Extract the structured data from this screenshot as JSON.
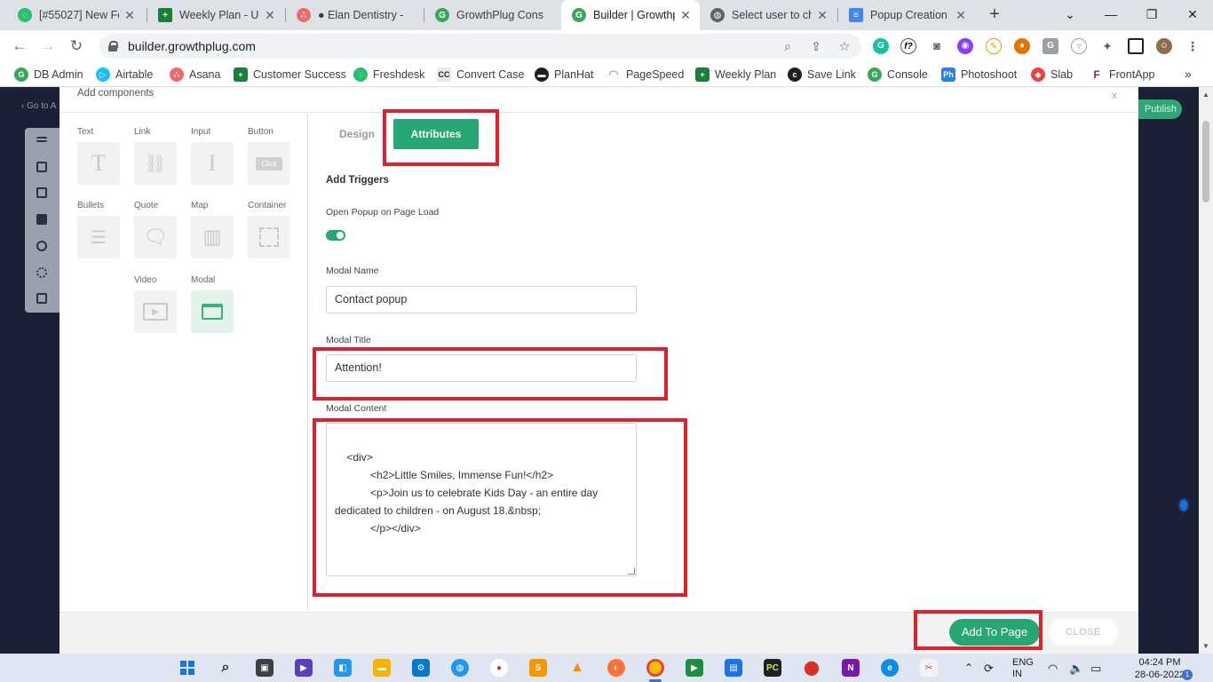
{
  "browser": {
    "tabs": [
      {
        "title": "[#55027] New Fe",
        "favicon": "freshdesk-icon",
        "color": "#25c16f",
        "active": false
      },
      {
        "title": "Weekly Plan - UI/",
        "favicon": "sheets-icon",
        "color": "#188038",
        "active": false
      },
      {
        "title": "● Elan Dentistry -",
        "favicon": "asana-icon",
        "color": "#f06a6a",
        "active": false
      },
      {
        "title": "GrowthPlug Cons",
        "favicon": "growthplug-icon",
        "color": "#3aa757",
        "active": false
      },
      {
        "title": "Builder | Growthp",
        "favicon": "growthplug-icon",
        "color": "#3aa757",
        "active": true
      },
      {
        "title": "Select user to ch",
        "favicon": "globe-icon",
        "color": "#5f6368",
        "active": false
      },
      {
        "title": "Popup Creation -",
        "favicon": "docs-icon",
        "color": "#4285f4",
        "active": false
      }
    ],
    "url": "builder.growthplug.com",
    "bookmarks": [
      {
        "label": "DB Admin",
        "icon": "growthplug-icon",
        "color": "#3aa757"
      },
      {
        "label": "Airtable",
        "icon": "airtable-icon",
        "color": "#18bfff"
      },
      {
        "label": "Asana",
        "icon": "asana-icon",
        "color": "#f06a6a"
      },
      {
        "label": "Customer Success",
        "icon": "sheets-icon",
        "color": "#188038"
      },
      {
        "label": "Freshdesk",
        "icon": "freshdesk-icon",
        "color": "#25c16f"
      },
      {
        "label": "Convert Case",
        "icon": "convert-case-icon",
        "color": "#555555"
      },
      {
        "label": "PlanHat",
        "icon": "planhat-icon",
        "color": "#1f1f1f"
      },
      {
        "label": "PageSpeed",
        "icon": "pagespeed-icon",
        "color": "#4285f4"
      },
      {
        "label": "Weekly Plan",
        "icon": "sheets-icon",
        "color": "#188038"
      },
      {
        "label": "Save Link",
        "icon": "save-link-icon",
        "color": "#1f1f1f"
      },
      {
        "label": "Console",
        "icon": "growthplug-icon",
        "color": "#3aa757"
      },
      {
        "label": "Photoshoot",
        "icon": "photoshop-icon",
        "color": "#2d7fe6"
      },
      {
        "label": "Slab",
        "icon": "slab-icon",
        "color": "#e8453c"
      },
      {
        "label": "FrontApp",
        "icon": "frontapp-icon",
        "color": "#a01e6e"
      }
    ],
    "convert_case_abbr": "CC",
    "photoshoot_abbr": "Ph"
  },
  "page": {
    "goto_label": "Go to A",
    "publish_label": "Publish"
  },
  "modal": {
    "title": "Add components",
    "close_label": "x",
    "components": [
      {
        "label": "Text",
        "icon": "text-icon",
        "glyph": "T"
      },
      {
        "label": "Link",
        "icon": "link-icon",
        "glyph": "🔗"
      },
      {
        "label": "Input",
        "icon": "input-icon",
        "glyph": "I"
      },
      {
        "label": "Button",
        "icon": "button-icon",
        "glyph": "Click"
      },
      {
        "label": "Bullets",
        "icon": "bullets-icon",
        "glyph": "☰"
      },
      {
        "label": "Quote",
        "icon": "quote-icon",
        "glyph": "☐"
      },
      {
        "label": "Map",
        "icon": "map-icon",
        "glyph": "▥"
      },
      {
        "label": "Container",
        "icon": "container-icon",
        "glyph": "⬚"
      },
      {
        "label": "Video",
        "icon": "video-icon",
        "glyph": "▶"
      },
      {
        "label": "Modal",
        "icon": "modal-icon",
        "glyph": "▭"
      }
    ],
    "tabs": {
      "design": "Design",
      "attributes": "Attributes"
    },
    "form": {
      "triggers_heading": "Add Triggers",
      "open_on_load_label": "Open Popup on Page Load",
      "open_on_load": true,
      "modal_name_label": "Modal Name",
      "modal_name_value": "Contact popup",
      "modal_title_label": "Modal Title",
      "modal_title_value": "Attention!",
      "modal_content_label": "Modal Content",
      "modal_content_value": "<div>\n            <h2>Little Smiles, Immense Fun!</h2>\n            <p>Join us to celebrate Kids Day - an entire day dedicated to children - on August 18.&nbsp;\n            </p></div>"
    },
    "footer": {
      "add_to_page": "Add To Page",
      "close": "CLOSE"
    }
  },
  "taskbar": {
    "language": "ENG",
    "language_sub": "IN",
    "time": "04:24 PM",
    "date": "28-06-2022",
    "notifications": "1"
  },
  "colors": {
    "accent_green": "#27a774",
    "annotation_red": "#e0202a"
  }
}
